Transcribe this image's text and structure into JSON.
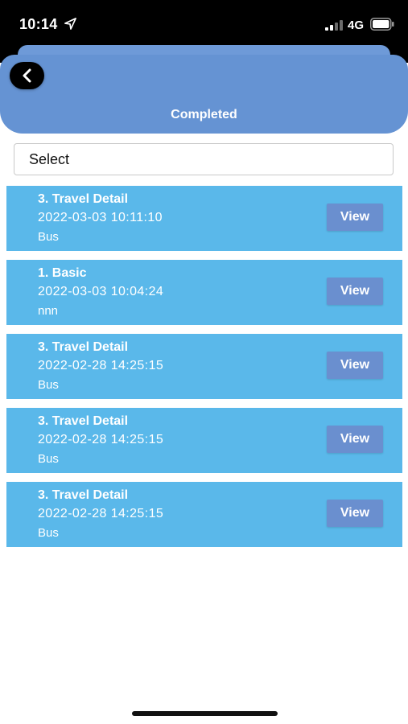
{
  "status_bar": {
    "time": "10:14",
    "network": "4G",
    "icons": [
      "location-arrow-icon",
      "cellular-signal-icon",
      "battery-icon"
    ]
  },
  "header": {
    "title": "Completed",
    "back_icon": "chevron-left-icon"
  },
  "filter": {
    "select_label": "Select"
  },
  "records": [
    {
      "title": "3. Travel Detail",
      "datetime": "2022-03-03 10:11:10",
      "mode": "Bus",
      "action": "View"
    },
    {
      "title": "1. Basic",
      "datetime": "2022-03-03 10:04:24",
      "mode": "nnn",
      "action": "View"
    },
    {
      "title": "3. Travel Detail",
      "datetime": "2022-02-28 14:25:15",
      "mode": "Bus",
      "action": "View"
    },
    {
      "title": "3. Travel Detail",
      "datetime": "2022-02-28 14:25:15",
      "mode": "Bus",
      "action": "View"
    },
    {
      "title": "3. Travel Detail",
      "datetime": "2022-02-28 14:25:15",
      "mode": "Bus",
      "action": "View"
    }
  ],
  "colors": {
    "header": "#6593d3",
    "card": "#5ab8ea",
    "view_button": "#6a8fcf"
  }
}
